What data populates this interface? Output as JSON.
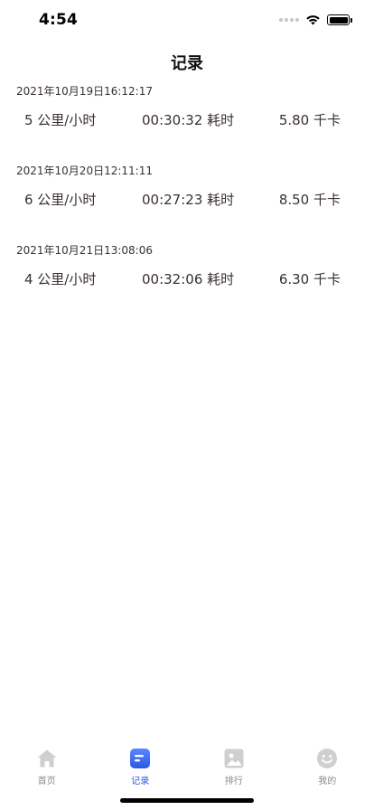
{
  "status_bar": {
    "time": "4:54"
  },
  "header": {
    "title": "记录"
  },
  "records": [
    {
      "date": "2021年10月19日16:12:17",
      "speed": "5 公里/小时",
      "duration": "00:30:32 耗时",
      "calories": "5.80 千卡"
    },
    {
      "date": "2021年10月20日12:11:11",
      "speed": "6 公里/小时",
      "duration": "00:27:23 耗时",
      "calories": "8.50 千卡"
    },
    {
      "date": "2021年10月21日13:08:06",
      "speed": "4 公里/小时",
      "duration": "00:32:06 耗时",
      "calories": "6.30 千卡"
    }
  ],
  "tab_bar": {
    "active_color": "#2b59e6",
    "inactive_color": "#cfcfcf",
    "tabs": [
      {
        "label": "首页",
        "icon": "home-icon"
      },
      {
        "label": "记录",
        "icon": "record-icon"
      },
      {
        "label": "排行",
        "icon": "ranking-icon"
      },
      {
        "label": "我的",
        "icon": "profile-icon"
      }
    ],
    "active_index": 1
  }
}
